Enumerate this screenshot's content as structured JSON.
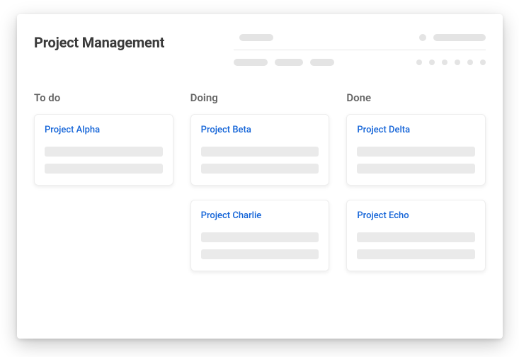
{
  "header": {
    "title": "Project Management"
  },
  "board": {
    "columns": [
      {
        "title": "To do",
        "cards": [
          {
            "title": "Project Alpha"
          }
        ]
      },
      {
        "title": "Doing",
        "cards": [
          {
            "title": "Project Beta"
          },
          {
            "title": "Project Charlie"
          }
        ]
      },
      {
        "title": "Done",
        "cards": [
          {
            "title": "Project Delta"
          },
          {
            "title": "Project Echo"
          }
        ]
      }
    ]
  }
}
